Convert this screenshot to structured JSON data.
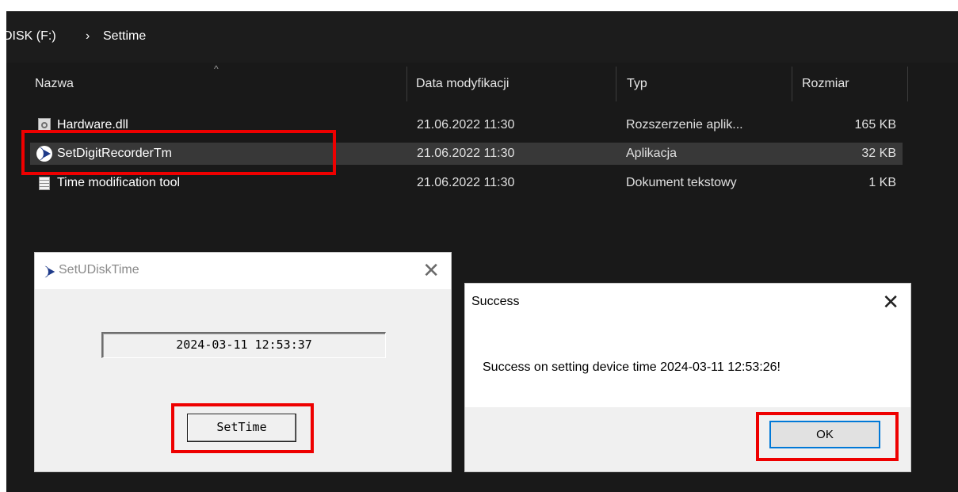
{
  "explorer": {
    "breadcrumb": {
      "drive": "DISK (F:)",
      "separator": "›",
      "folder": "Settime"
    },
    "sort_indicator": "^",
    "columns": {
      "name": "Nazwa",
      "date": "Data modyfikacji",
      "type": "Typ",
      "size": "Rozmiar"
    },
    "files": [
      {
        "name": "Hardware.dll",
        "date": "21.06.2022 11:30",
        "type": "Rozszerzenie aplik...",
        "size": "165 KB",
        "icon": "dll-icon"
      },
      {
        "name": "SetDigitRecorderTm",
        "date": "21.06.2022 11:30",
        "type": "Aplikacja",
        "size": "32 KB",
        "icon": "app-icon",
        "selected": true
      },
      {
        "name": "Time modification tool",
        "date": "21.06.2022 11:30",
        "type": "Dokument tekstowy",
        "size": "1 KB",
        "icon": "text-file-icon"
      }
    ]
  },
  "setudisk_dialog": {
    "title": "SetUDiskTime",
    "close_glyph": "✕",
    "time_value": "2024-03-11 12:53:37",
    "button_label": "SetTime"
  },
  "success_dialog": {
    "title": "Success",
    "close_glyph": "✕",
    "message": "Success on setting device time 2024-03-11 12:53:26!",
    "ok_label": "OK"
  },
  "colors": {
    "highlight_box": "#ee0000",
    "explorer_bg": "#191919",
    "dialog_bg": "#f0f0f0",
    "ok_focus": "#0078d7"
  }
}
